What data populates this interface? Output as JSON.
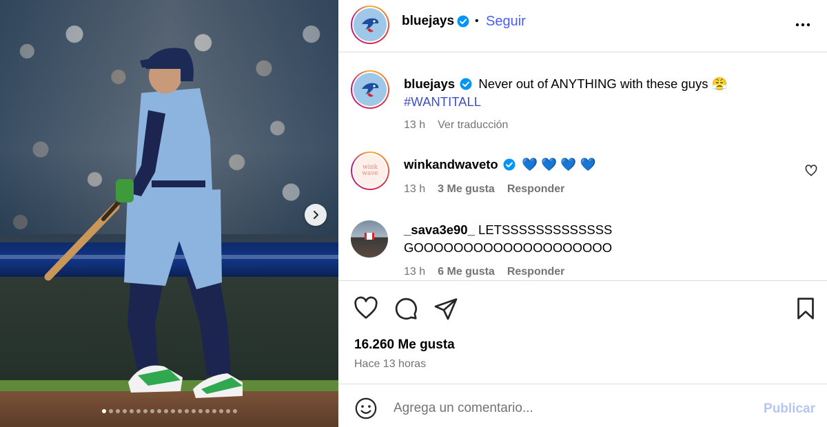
{
  "media": {
    "carousel_total": 20,
    "carousel_active": 0
  },
  "header": {
    "username": "bluejays",
    "separator": "•",
    "follow_label": "Seguir",
    "options_icon": "more-horizontal-icon"
  },
  "caption": {
    "username": "bluejays",
    "text": "Never out of ANYTHING with these guys 😤",
    "hashtag": "#WANTITALL",
    "time": "13 h",
    "translate_label": "Ver traducción"
  },
  "comments": [
    {
      "username": "winkandwaveto",
      "text": "💙 💙 💙 💙",
      "time": "13 h",
      "likes": "3 Me gusta",
      "reply_label": "Responder",
      "avatar_text": "wink wave"
    },
    {
      "username": "_sava3e90_",
      "text_line1": "LETSSSSSSSSSSSSS",
      "text_line2": "GOOOOOOOOOOOOOOOOOOOO",
      "time": "13 h",
      "likes": "6 Me gusta",
      "reply_label": "Responder"
    }
  ],
  "actions": {
    "like_icon": "heart-icon",
    "comment_icon": "comment-icon",
    "share_icon": "share-icon",
    "save_icon": "bookmark-icon",
    "likes_count": "16.260 Me gusta",
    "posted": "Hace 13 horas"
  },
  "composer": {
    "placeholder": "Agrega un comentario...",
    "value": "",
    "publish_label": "Publicar"
  },
  "colors": {
    "link_blue": "#4a5df9",
    "hashtag_blue": "#3f4fc7",
    "verified_blue": "#0095f6",
    "secondary_text": "#737373",
    "publish_disabled": "#b3c6f5"
  }
}
